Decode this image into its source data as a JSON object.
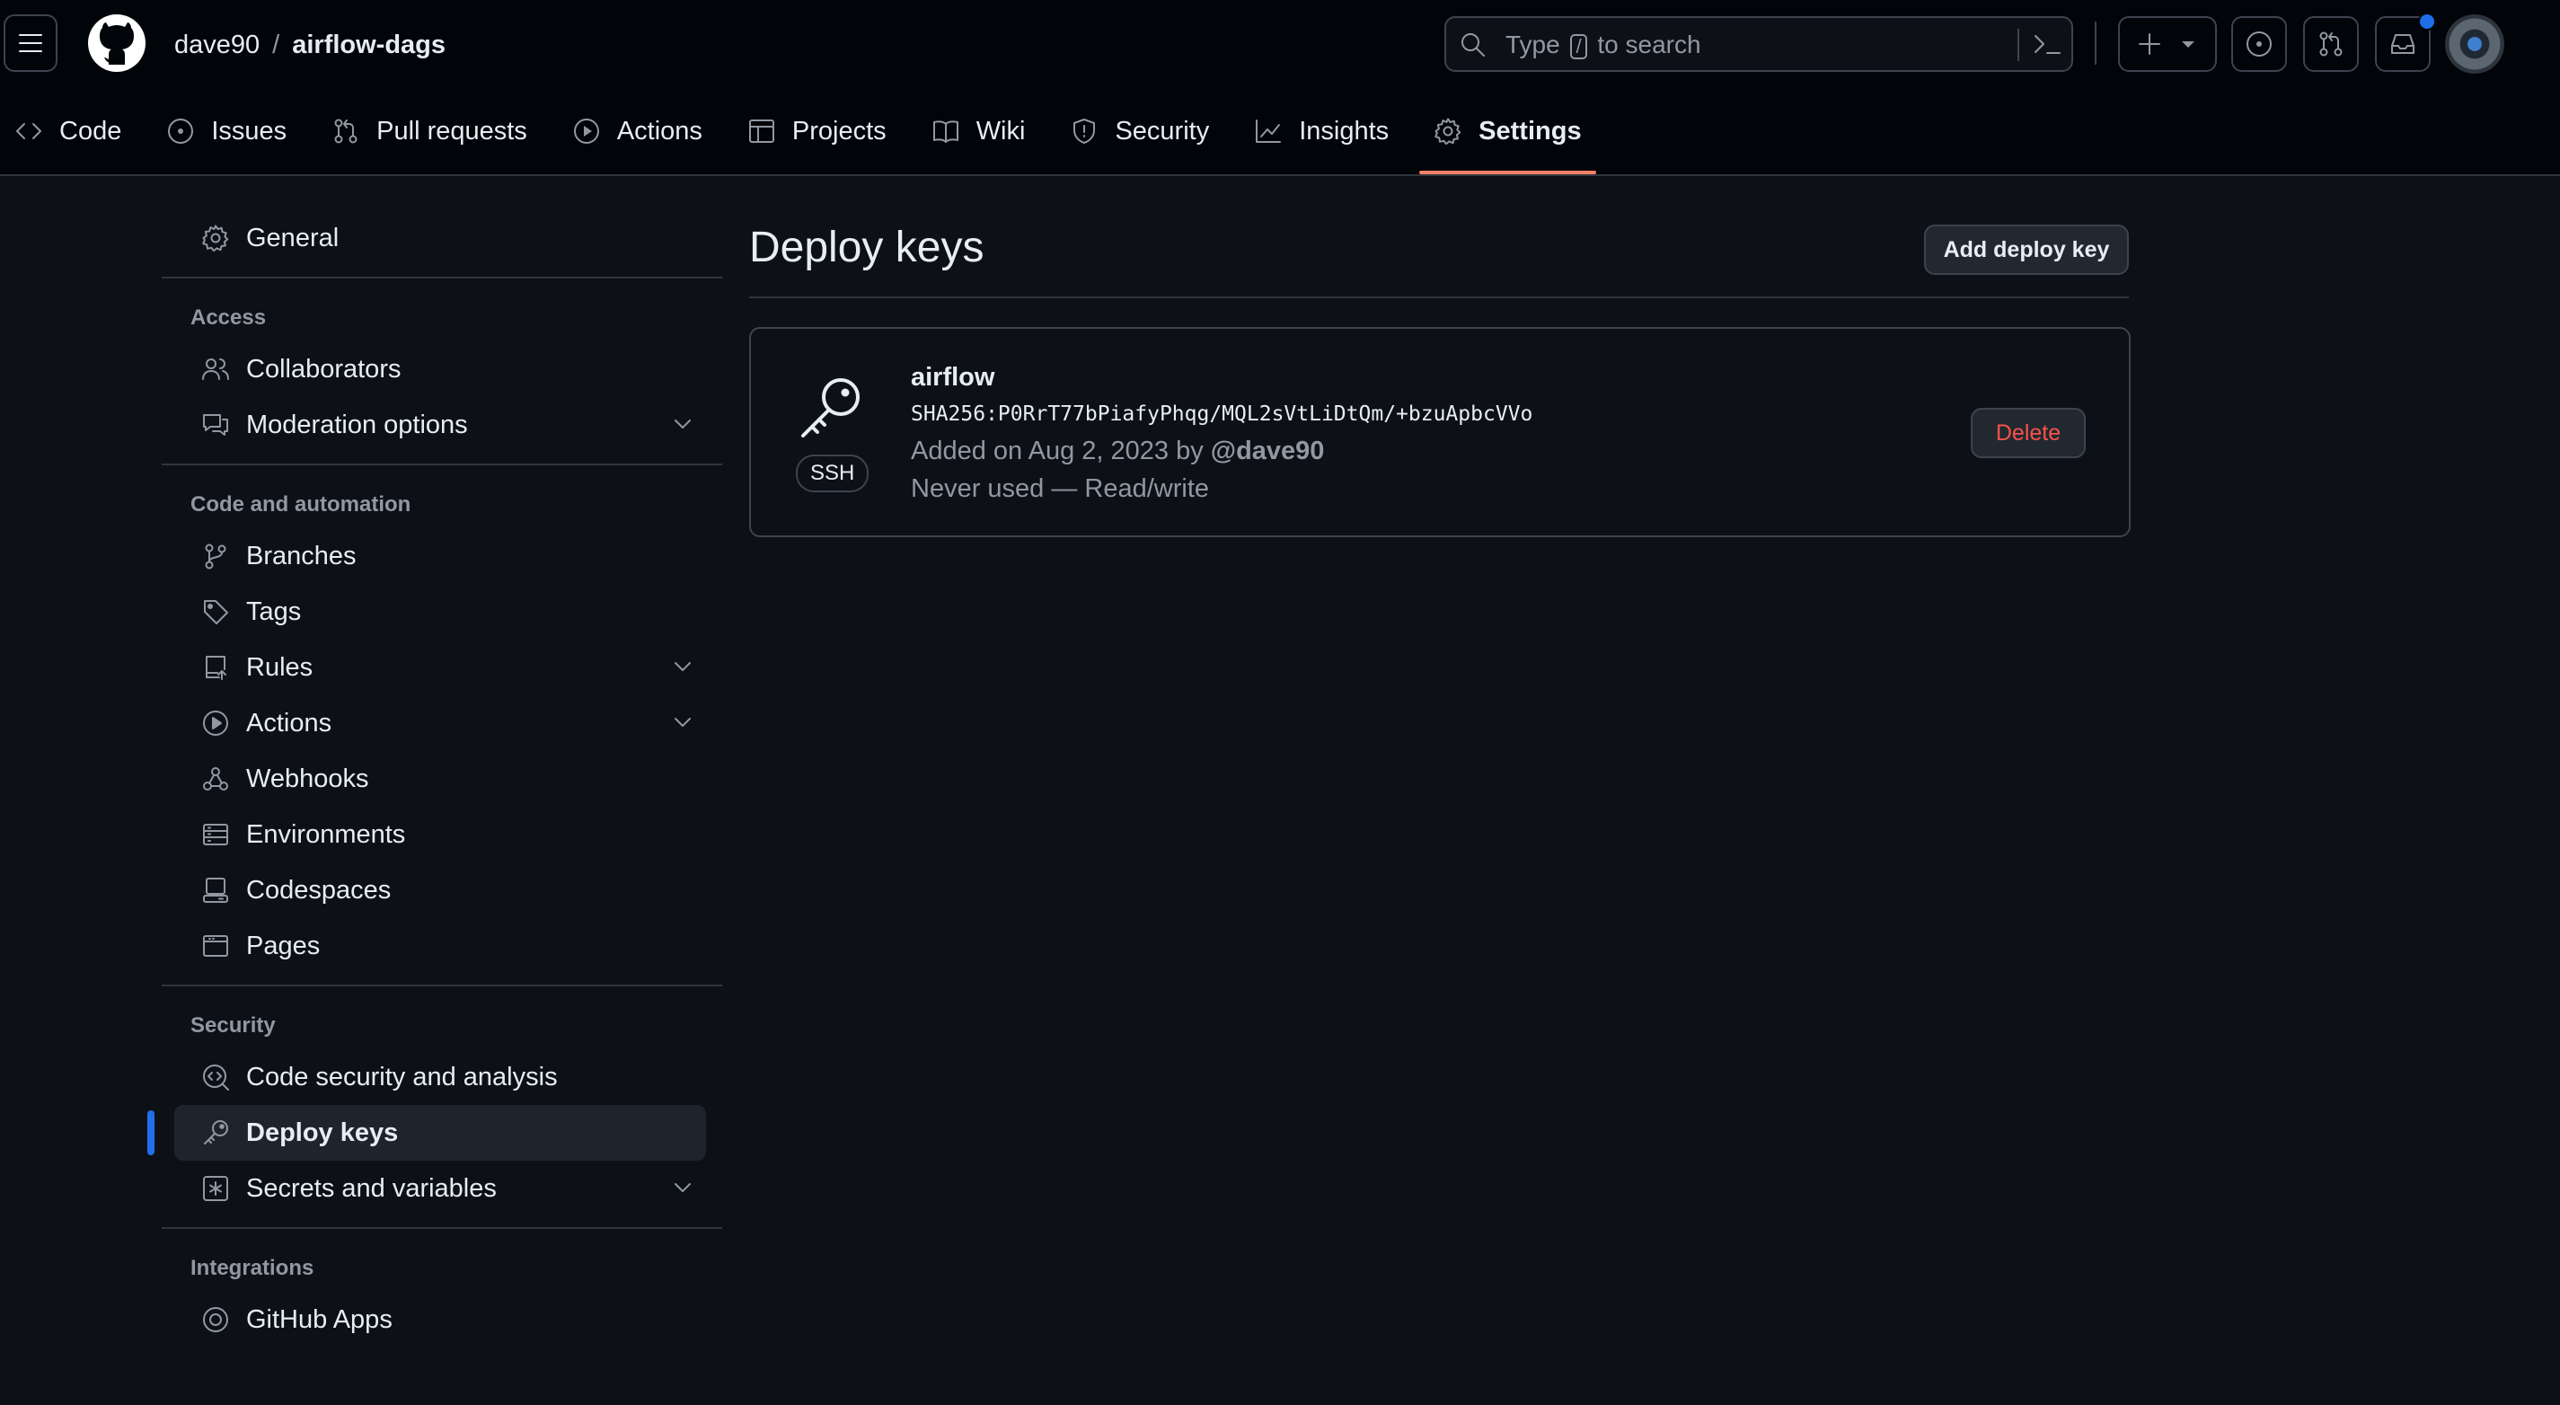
{
  "header": {
    "owner": "dave90",
    "separator": "/",
    "repo": "airflow-dags",
    "search": {
      "prefix": "Type",
      "key": "/",
      "suffix": "to search"
    },
    "icons": [
      "hamburger-icon",
      "github-logo-icon",
      "search-icon",
      "command-palette-icon",
      "plus-icon",
      "issue-icon",
      "pull-request-icon",
      "inbox-icon"
    ]
  },
  "repo_nav": {
    "tabs": [
      {
        "label": "Code",
        "icon": "code-icon"
      },
      {
        "label": "Issues",
        "icon": "issue-icon"
      },
      {
        "label": "Pull requests",
        "icon": "pull-request-icon"
      },
      {
        "label": "Actions",
        "icon": "play-icon"
      },
      {
        "label": "Projects",
        "icon": "table-icon"
      },
      {
        "label": "Wiki",
        "icon": "book-icon"
      },
      {
        "label": "Security",
        "icon": "shield-icon"
      },
      {
        "label": "Insights",
        "icon": "graph-icon"
      },
      {
        "label": "Settings",
        "icon": "gear-icon",
        "selected": true
      }
    ]
  },
  "sidebar": {
    "general": "General",
    "access": {
      "heading": "Access",
      "items": [
        {
          "label": "Collaborators"
        },
        {
          "label": "Moderation options",
          "expandable": true
        }
      ]
    },
    "code_automation": {
      "heading": "Code and automation",
      "items": [
        {
          "label": "Branches"
        },
        {
          "label": "Tags"
        },
        {
          "label": "Rules",
          "expandable": true
        },
        {
          "label": "Actions",
          "expandable": true
        },
        {
          "label": "Webhooks"
        },
        {
          "label": "Environments"
        },
        {
          "label": "Codespaces"
        },
        {
          "label": "Pages"
        }
      ]
    },
    "security": {
      "heading": "Security",
      "items": [
        {
          "label": "Code security and analysis"
        },
        {
          "label": "Deploy keys",
          "active": true
        },
        {
          "label": "Secrets and variables",
          "expandable": true
        }
      ]
    },
    "integrations": {
      "heading": "Integrations",
      "items": [
        {
          "label": "GitHub Apps"
        }
      ]
    }
  },
  "main": {
    "title": "Deploy keys",
    "add_button": "Add deploy key",
    "keys": [
      {
        "title": "airflow",
        "type_badge": "SSH",
        "fingerprint": "SHA256:P0RrT77bPiafyPhqg/MQL2sVtLiDtQm/+bzuApbcVVo",
        "added_prefix": "Added on Aug 2, 2023 by",
        "added_by": "@dave90",
        "usage": "Never used — Read/write",
        "delete_label": "Delete"
      }
    ]
  },
  "colors": {
    "background": "#0d1117",
    "header_background": "#010409",
    "border": "#30363d",
    "accent_underline": "#f78166",
    "active_indicator": "#1f6feb",
    "danger": "#f85149",
    "muted_text": "#9198a1"
  }
}
